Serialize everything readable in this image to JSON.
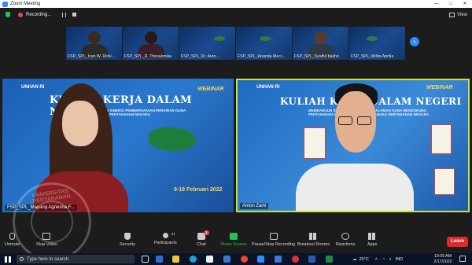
{
  "window": {
    "title": "Zoom Meeting",
    "minimize": "—",
    "maximize": "□",
    "close": "✕"
  },
  "topbar": {
    "recording_label": "Recording...",
    "view_label": "View",
    "shield_icon": "shield-icon"
  },
  "gallery": {
    "thumbnails": [
      {
        "label": "FSP_SPL_Ican W. Ricki..."
      },
      {
        "label": "FSP_SPL_R. Thesalonika"
      },
      {
        "label": "FSP_SPL_Dr. Aran..."
      },
      {
        "label": "FSP_SPL_Ananda Meci..."
      },
      {
        "label": "FSP_SPL_Syaiful bakhri"
      },
      {
        "label": "FSP_SPL_Wilda Aprilia"
      }
    ],
    "next_label": "›"
  },
  "tiles": {
    "left": {
      "name": "FSP_SPL_Mayang Agnesha F...",
      "org": "UNHAN RI",
      "title": "KULIAH KERJA DALAM NEGERI",
      "subtitle": "MEMBANGUN SINERGI PEMBERDAYAAN PERAIRAN GUNA MENDUKUNG PERTAHANAN NEGARA",
      "date": "9-18 Februari 2022",
      "webinar": "WEBINAR"
    },
    "right": {
      "name": "Anton Zaini",
      "org": "UNHAN RI",
      "title": "KULIAH KERJA DALAM NEGERI",
      "subtitle": "MEMBANGUN SINERGI PERAIRAN PEDALAMAN GUNA MENDUKUNG PERTAHANAN NON MILITER DALAM RANGKA PERTAHANAN NEGARA",
      "webinar": "WEBINAR",
      "accent": "#c8e33b"
    }
  },
  "watermark": {
    "text": "UNIVERSITAS PERTAHANAN"
  },
  "controls": {
    "unmute": "Unmute",
    "stop_video": "Stop Video",
    "security": "Security",
    "participants": "Participants",
    "participants_count": "21",
    "chat": "Chat",
    "chat_badge": "1",
    "share_screen": "Share Screen",
    "record": "Pause/Stop Recording",
    "breakout": "Breakout Rooms",
    "reactions": "Reactions",
    "apps": "Apps",
    "leave": "Leave",
    "share_color": "#27c24c",
    "leave_color": "#e02828"
  },
  "taskbar": {
    "search_placeholder": "Type here to search",
    "weather": "29°C",
    "language": "IND",
    "time": "10:09 AM",
    "date": "2/17/2022"
  }
}
